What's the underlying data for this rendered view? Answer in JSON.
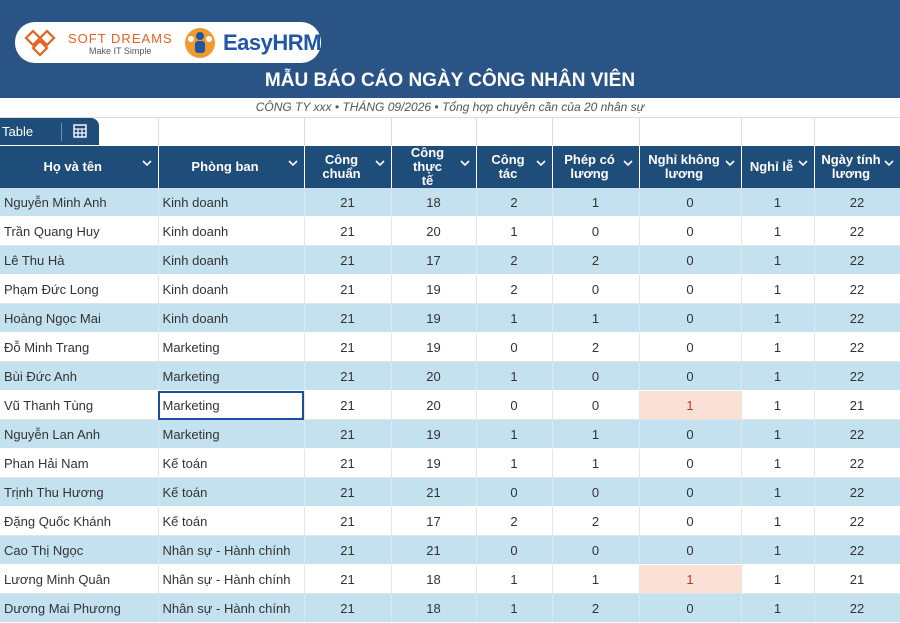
{
  "brand": {
    "softdreams_name": "SOFT DREAMS",
    "softdreams_tagline": "Make IT Simple",
    "easyhrm_name": "EasyHRM"
  },
  "report": {
    "title": "MẪU BÁO CÁO NGÀY CÔNG NHÂN VIÊN",
    "subtitle": "CÔNG TY xxx • THÁNG 09/2026 • Tổng hợp chuyên cần của 20 nhân sự"
  },
  "toolbar": {
    "table_tab_label": "Table",
    "icon": "table-grid-icon"
  },
  "columns": [
    {
      "label_line1": "Họ và tên",
      "label_line2": ""
    },
    {
      "label_line1": "Phòng ban",
      "label_line2": ""
    },
    {
      "label_line1": "Công",
      "label_line2": "chuẩn"
    },
    {
      "label_line1": "Công thực",
      "label_line2": "tế"
    },
    {
      "label_line1": "Công",
      "label_line2": "tác"
    },
    {
      "label_line1": "Phép có",
      "label_line2": "lương"
    },
    {
      "label_line1": "Nghỉ không",
      "label_line2": "lương"
    },
    {
      "label_line1": "Nghỉ lễ",
      "label_line2": ""
    },
    {
      "label_line1": "Ngày tính",
      "label_line2": "lương"
    }
  ],
  "rows": [
    {
      "name": "Nguyễn Minh Anh",
      "dept": "Kinh doanh",
      "std": "21",
      "actual": "18",
      "trip": "2",
      "paid_leave": "1",
      "unpaid": "0",
      "holiday": "1",
      "pay_days": "22"
    },
    {
      "name": "Trần Quang Huy",
      "dept": "Kinh doanh",
      "std": "21",
      "actual": "20",
      "trip": "1",
      "paid_leave": "0",
      "unpaid": "0",
      "holiday": "1",
      "pay_days": "22"
    },
    {
      "name": "Lê Thu Hà",
      "dept": "Kinh doanh",
      "std": "21",
      "actual": "17",
      "trip": "2",
      "paid_leave": "2",
      "unpaid": "0",
      "holiday": "1",
      "pay_days": "22"
    },
    {
      "name": "Phạm Đức Long",
      "dept": "Kinh doanh",
      "std": "21",
      "actual": "19",
      "trip": "2",
      "paid_leave": "0",
      "unpaid": "0",
      "holiday": "1",
      "pay_days": "22"
    },
    {
      "name": "Hoàng Ngọc Mai",
      "dept": "Kinh doanh",
      "std": "21",
      "actual": "19",
      "trip": "1",
      "paid_leave": "1",
      "unpaid": "0",
      "holiday": "1",
      "pay_days": "22"
    },
    {
      "name": "Đỗ Minh Trang",
      "dept": "Marketing",
      "std": "21",
      "actual": "19",
      "trip": "0",
      "paid_leave": "2",
      "unpaid": "0",
      "holiday": "1",
      "pay_days": "22"
    },
    {
      "name": "Bùi Đức Anh",
      "dept": "Marketing",
      "std": "21",
      "actual": "20",
      "trip": "1",
      "paid_leave": "0",
      "unpaid": "0",
      "holiday": "1",
      "pay_days": "22"
    },
    {
      "name": "Vũ Thanh Tùng",
      "dept": "Marketing",
      "std": "21",
      "actual": "20",
      "trip": "0",
      "paid_leave": "0",
      "unpaid": "1",
      "holiday": "1",
      "pay_days": "21"
    },
    {
      "name": "Nguyễn Lan Anh",
      "dept": "Marketing",
      "std": "21",
      "actual": "19",
      "trip": "1",
      "paid_leave": "1",
      "unpaid": "0",
      "holiday": "1",
      "pay_days": "22"
    },
    {
      "name": "Phan Hải Nam",
      "dept": "Kế toán",
      "std": "21",
      "actual": "19",
      "trip": "1",
      "paid_leave": "1",
      "unpaid": "0",
      "holiday": "1",
      "pay_days": "22"
    },
    {
      "name": "Trịnh Thu Hương",
      "dept": "Kế toán",
      "std": "21",
      "actual": "21",
      "trip": "0",
      "paid_leave": "0",
      "unpaid": "0",
      "holiday": "1",
      "pay_days": "22"
    },
    {
      "name": "Đặng Quốc Khánh",
      "dept": "Kế toán",
      "std": "21",
      "actual": "17",
      "trip": "2",
      "paid_leave": "2",
      "unpaid": "0",
      "holiday": "1",
      "pay_days": "22"
    },
    {
      "name": "Cao Thị Ngọc",
      "dept": "Nhân sự - Hành chính",
      "std": "21",
      "actual": "21",
      "trip": "0",
      "paid_leave": "0",
      "unpaid": "0",
      "holiday": "1",
      "pay_days": "22"
    },
    {
      "name": "Lương Minh Quân",
      "dept": "Nhân sự - Hành chính",
      "std": "21",
      "actual": "18",
      "trip": "1",
      "paid_leave": "1",
      "unpaid": "1",
      "holiday": "1",
      "pay_days": "21"
    },
    {
      "name": "Dương Mai Phương",
      "dept": "Nhân sự - Hành chính",
      "std": "21",
      "actual": "18",
      "trip": "1",
      "paid_leave": "2",
      "unpaid": "0",
      "holiday": "1",
      "pay_days": "22"
    }
  ],
  "selected_row_index": 7,
  "highlight_color": "#fbe0d5",
  "header_color": "#1f4d7a",
  "banner_color": "#2a5486"
}
